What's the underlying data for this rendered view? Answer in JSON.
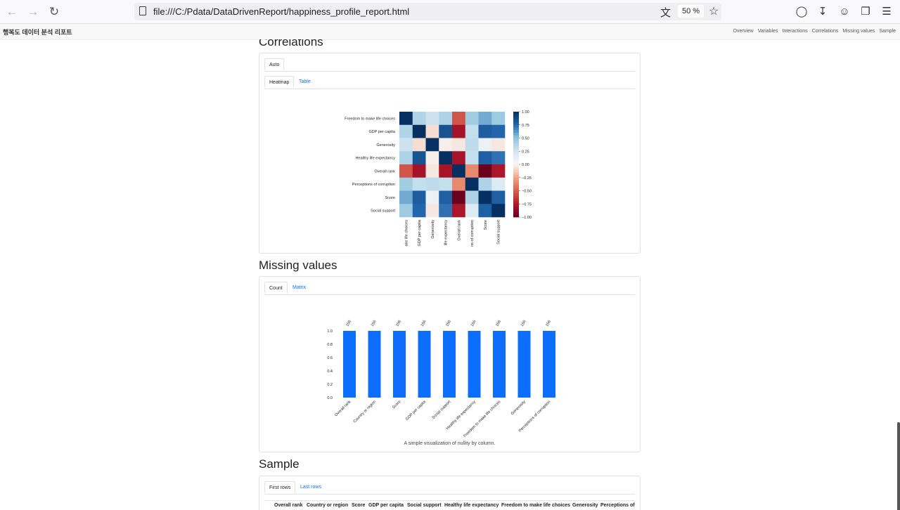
{
  "browser": {
    "url": "file:///C:/Pdata/DataDrivenReport/happiness_profile_report.html",
    "zoom": "50 %"
  },
  "navbar": {
    "brand": "행복도 데이터 분석 리포트",
    "links": [
      "Overview",
      "Variables",
      "Interactions",
      "Correlations",
      "Missing values",
      "Sample"
    ]
  },
  "correlations": {
    "title": "Correlations",
    "mode_tab": "Auto",
    "tabs": [
      "Heatmap",
      "Table"
    ]
  },
  "missing": {
    "title": "Missing values",
    "tabs": [
      "Count",
      "Matrix"
    ],
    "caption": "A simple visualization of nullity by column."
  },
  "sample": {
    "title": "Sample",
    "tabs": [
      "First rows",
      "Last rows"
    ],
    "columns": [
      "Overall rank",
      "Country or region",
      "Score",
      "GDP per capita",
      "Social support",
      "Healthy life expectancy",
      "Freedom to make life choices",
      "Generosity",
      "Perceptions of"
    ]
  },
  "colors": {
    "bar": "#0d6efd",
    "link": "#0d6efd"
  },
  "chart_data": [
    {
      "type": "heatmap",
      "row_labels": [
        "Freedom to make life choices",
        "GDP per capita",
        "Generosity",
        "Healthy life expectancy",
        "Overall rank",
        "Perceptions of corruption",
        "Score",
        "Social support"
      ],
      "col_labels": [
        "ake life choices",
        "GDP per capita",
        "Generosity",
        "life expectancy",
        "Overall rank",
        "ns of corruption",
        "Score",
        "Social support"
      ],
      "values": [
        [
          1.0,
          0.38,
          0.27,
          0.39,
          -0.54,
          0.44,
          0.57,
          0.45
        ],
        [
          0.38,
          1.0,
          -0.08,
          0.84,
          -0.8,
          0.3,
          0.79,
          0.75
        ],
        [
          0.27,
          -0.08,
          1.0,
          -0.03,
          -0.05,
          0.33,
          0.08,
          -0.05
        ],
        [
          0.39,
          0.84,
          -0.03,
          1.0,
          -0.79,
          0.3,
          0.78,
          0.72
        ],
        [
          -0.54,
          -0.8,
          -0.05,
          -0.79,
          1.0,
          -0.35,
          -0.99,
          -0.77
        ],
        [
          0.44,
          0.3,
          0.33,
          0.3,
          -0.35,
          1.0,
          0.39,
          0.18
        ],
        [
          0.57,
          0.79,
          0.08,
          0.78,
          -0.99,
          0.39,
          1.0,
          0.78
        ],
        [
          0.45,
          0.75,
          -0.05,
          0.72,
          -0.77,
          0.18,
          0.78,
          1.0
        ]
      ],
      "colorbar_ticks": [
        "1.00",
        "0.75",
        "0.50",
        "0.25",
        "0.00",
        "−0.25",
        "−0.50",
        "−0.75",
        "−1.00"
      ],
      "vmin": -1,
      "vmax": 1
    },
    {
      "type": "bar",
      "categories": [
        "Overall rank",
        "Country or region",
        "Score",
        "GDP per capita",
        "Social support",
        "Healthy life expectancy",
        "Freedom to make life choices",
        "Generosity",
        "Perceptions of corruption"
      ],
      "values": [
        1.0,
        1.0,
        1.0,
        1.0,
        1.0,
        1.0,
        1.0,
        1.0,
        1.0
      ],
      "counts": [
        "156",
        "156",
        "156",
        "156",
        "156",
        "156",
        "156",
        "156",
        "156"
      ],
      "yticks": [
        "0.0",
        "0.2",
        "0.4",
        "0.6",
        "0.8",
        "1.0"
      ],
      "ylim": [
        0,
        1
      ]
    }
  ]
}
